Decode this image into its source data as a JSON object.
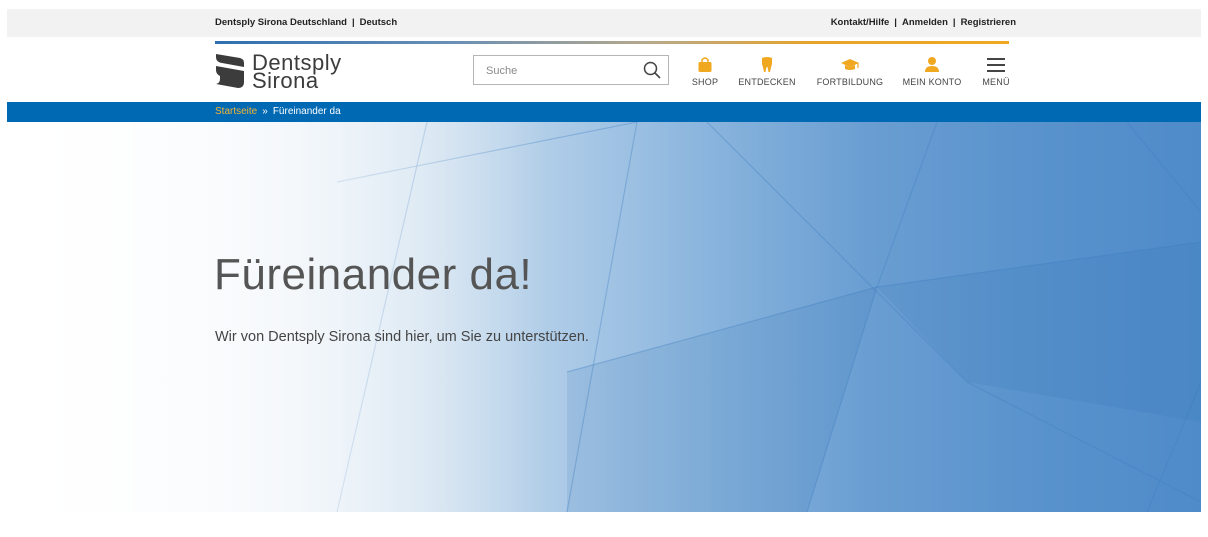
{
  "topbar": {
    "site": "Dentsply Sirona Deutschland",
    "separator": "|",
    "language": "Deutsch",
    "links": [
      "Kontakt/Hilfe",
      "Anmelden",
      "Registrieren"
    ]
  },
  "logo": {
    "line1": "Dentsply",
    "line2": "Sirona"
  },
  "search": {
    "placeholder": "Suche"
  },
  "nav": {
    "shop": "SHOP",
    "entdecken": "ENTDECKEN",
    "fortbildung": "FORTBILDUNG",
    "konto": "MEIN KONTO",
    "menu": "MENÜ"
  },
  "breadcrumb": {
    "home": "Startseite",
    "separator": "»",
    "current": "Füreinander da"
  },
  "hero": {
    "title": "Füreinander da!",
    "subtitle": "Wir von Dentsply Sirona sind hier, um Sie zu unterstützen."
  },
  "colors": {
    "primary": "#0069b4",
    "accent": "#f0a820",
    "text": "#555555"
  }
}
